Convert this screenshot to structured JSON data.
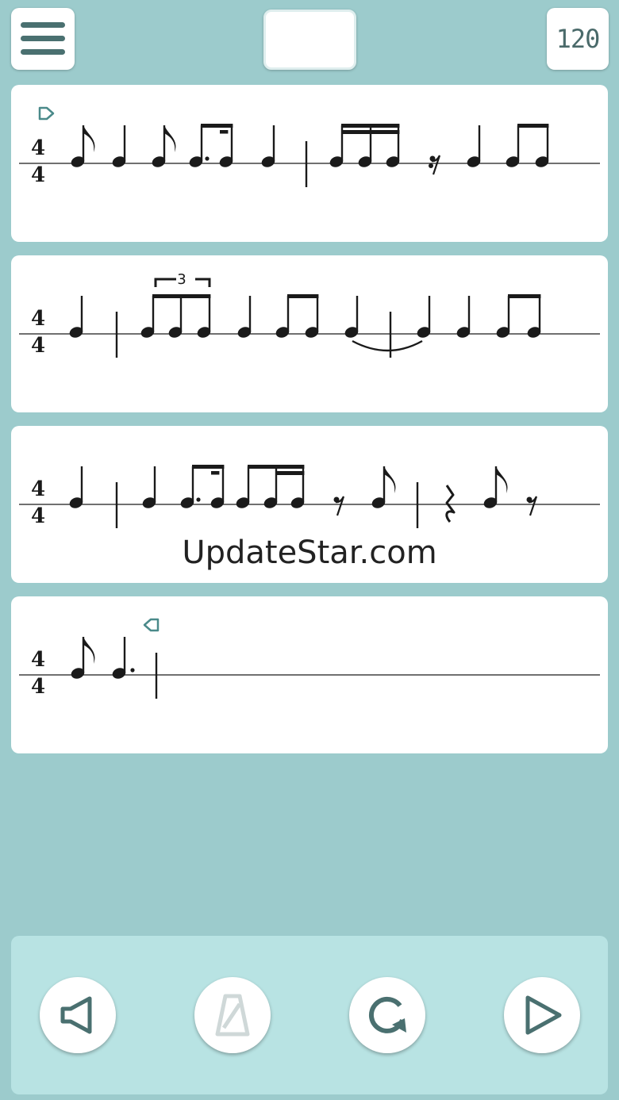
{
  "header": {
    "menu_icon": "hamburger-icon",
    "title": "",
    "tempo": "120"
  },
  "score": {
    "time_signature": {
      "top": "4",
      "bottom": "4"
    },
    "triplet_label": "3",
    "note_color": "#1a1a1a",
    "marker_color": "#4a8a8a",
    "staves": [
      {
        "id": "staff-1"
      },
      {
        "id": "staff-2"
      },
      {
        "id": "staff-3"
      },
      {
        "id": "staff-4"
      }
    ]
  },
  "watermark": "UpdateStar.com",
  "controls": {
    "buttons": [
      {
        "name": "mute-button",
        "icon": "speaker-icon"
      },
      {
        "name": "metronome-button",
        "icon": "metronome-icon",
        "disabled": true
      },
      {
        "name": "loop-button",
        "icon": "loop-icon"
      },
      {
        "name": "play-button",
        "icon": "play-icon"
      }
    ]
  },
  "colors": {
    "background": "#9ccbcc",
    "panel": "#b8e3e3",
    "icon": "#4a7070",
    "icon_disabled": "#cfd8d8"
  }
}
